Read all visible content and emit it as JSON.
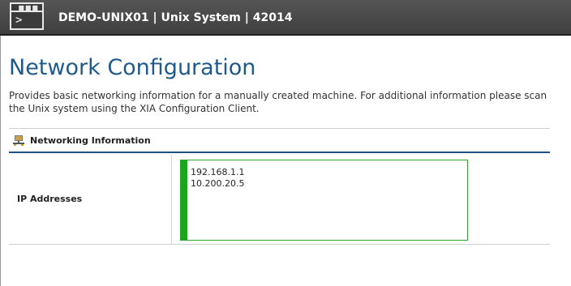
{
  "header": {
    "title": "DEMO-UNIX01 | Unix System | 42014",
    "icon": "terminal-icon",
    "icon_prompt": ">"
  },
  "page": {
    "title": "Network Configuration",
    "description": "Provides basic networking information for a manually created machine. For additional information please scan the Unix system using the XIA Configuration Client."
  },
  "section": {
    "label": "Networking Information",
    "icon": "network-icon"
  },
  "rows": [
    {
      "label": "IP Addresses",
      "values": [
        "192.168.1.1",
        "10.200.20.5"
      ],
      "status_color": "#1aa61a"
    }
  ],
  "colors": {
    "header_bg": "#4a4a4a",
    "title": "#1f5a8c",
    "section_rule": "#1f4f86",
    "status_green": "#1aa61a"
  }
}
